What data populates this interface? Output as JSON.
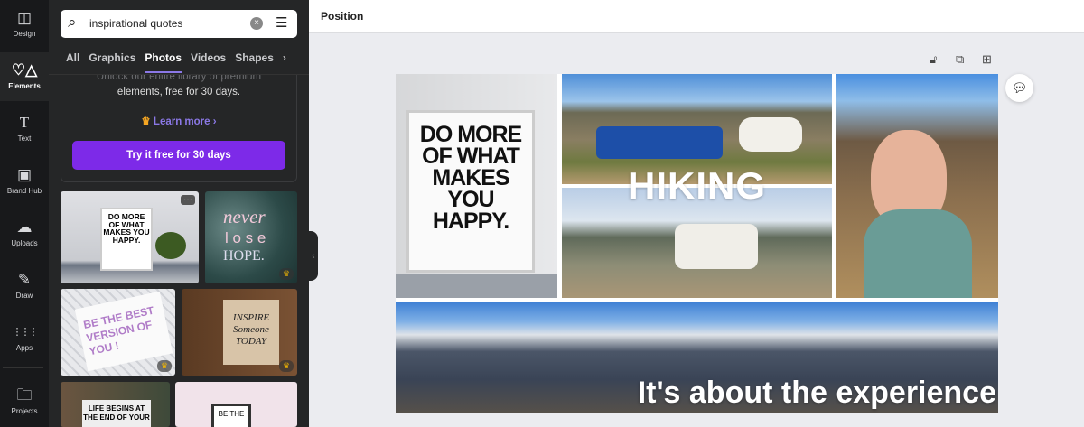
{
  "rail": [
    {
      "label": "Design",
      "icon": "layout-icon",
      "glyph": "◫"
    },
    {
      "label": "Elements",
      "icon": "shapes-icon",
      "glyph": "♡△"
    },
    {
      "label": "Text",
      "icon": "text-icon",
      "glyph": "T"
    },
    {
      "label": "Brand Hub",
      "icon": "brand-icon",
      "glyph": "▣"
    },
    {
      "label": "Uploads",
      "icon": "cloud-upload-icon",
      "glyph": "☁"
    },
    {
      "label": "Draw",
      "icon": "pen-icon",
      "glyph": "✎"
    },
    {
      "label": "Apps",
      "icon": "grid-icon",
      "glyph": "⋮⋮⋮"
    },
    {
      "label": "Projects",
      "icon": "folder-icon",
      "glyph": "🗀"
    }
  ],
  "search": {
    "value": "inspirational quotes"
  },
  "tabs": [
    "All",
    "Graphics",
    "Photos",
    "Videos",
    "Shapes"
  ],
  "active_tab": "Photos",
  "promo": {
    "line1": "Unlock our entire library of premium",
    "line2": "elements, free for 30 days.",
    "learn_more": "Learn more ›",
    "cta": "Try it free for 30 days"
  },
  "thumbs": {
    "t1": "DO MORE OF WHAT MAKES YOU HAPPY.",
    "t2a": "never",
    "t2b": "l o s e",
    "t2c": "HOPE.",
    "t3": "BE THE BEST VERSION OF YOU !",
    "t4": "INSPIRE Someone TODAY",
    "t5": "LIFE BEGINS AT THE END OF YOUR",
    "t6": "BE THE"
  },
  "topbar": {
    "position": "Position"
  },
  "canvas": {
    "poster": "DO MORE OF WHAT MAKES YOU HAPPY.",
    "heading": "HIKING",
    "caption": "It's about the experience"
  },
  "colors": {
    "accent": "#7d2ae8",
    "link": "#8b78e6"
  }
}
